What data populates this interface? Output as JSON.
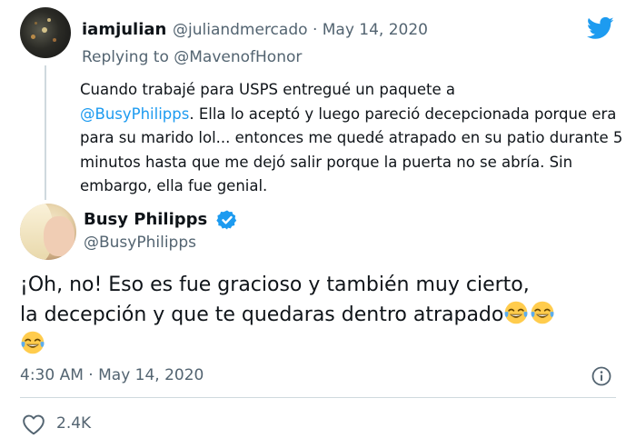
{
  "reply_tweet": {
    "display_name": "iamjulian",
    "handle": "@juliandmercado",
    "separator": "·",
    "date": "May 14, 2020",
    "replying_to_prefix": "Replying to ",
    "replying_to_handle": "@MavenofHonor",
    "text_before_mention": "Cuando trabajé para USPS entregué un paquete a",
    "mention": "@BusyPhilipps",
    "text_after_mention": ". Ella lo aceptó y luego pareció decepcionada porque era para su marido lol... entonces me quedé atrapado en su patio durante 5 minutos hasta que me dejó salir porque la puerta no se abría. Sin embargo, ella fue genial.",
    "avatar_icon": "user-avatar"
  },
  "main_tweet": {
    "display_name": "Busy Philipps",
    "handle": "@BusyPhilipps",
    "verified_icon": "verified-badge-icon",
    "line1": "¡Oh, no! Eso es fue gracioso y también muy cierto,",
    "line2": "la decepción y que te quedaras dentro atrapado",
    "emoji_icon": "face-with-tears-of-joy-icon",
    "time": "4:30 AM",
    "separator": "·",
    "date": "May 14, 2020",
    "likes": "2.4K",
    "info_icon": "info-icon",
    "like_icon": "heart-icon"
  },
  "brand": {
    "logo_icon": "twitter-bird-icon",
    "accent_color": "#1d9bf0",
    "text_color": "#0f1419",
    "muted_color": "#536471"
  }
}
